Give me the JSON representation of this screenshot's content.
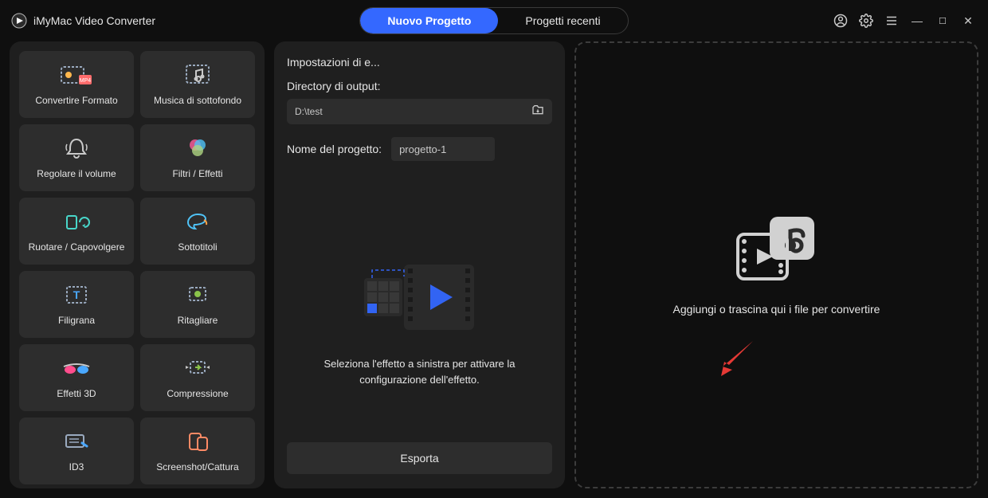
{
  "app": {
    "title": "iMyMac Video Converter"
  },
  "tabs": {
    "new_project": "Nuovo Progetto",
    "recent_projects": "Progetti recenti"
  },
  "sidebar": {
    "tools": [
      {
        "id": "convert-format",
        "label": "Convertire Formato"
      },
      {
        "id": "background-music",
        "label": "Musica di sottofondo"
      },
      {
        "id": "adjust-volume",
        "label": "Regolare il volume"
      },
      {
        "id": "filters-effects",
        "label": "Filtri / Effetti"
      },
      {
        "id": "rotate-flip",
        "label": "Ruotare / Capovolgere"
      },
      {
        "id": "subtitles",
        "label": "Sottotitoli"
      },
      {
        "id": "watermark",
        "label": "Filigrana"
      },
      {
        "id": "crop",
        "label": "Ritagliare"
      },
      {
        "id": "3d-effects",
        "label": "Effetti 3D"
      },
      {
        "id": "compression",
        "label": "Compressione"
      },
      {
        "id": "id3",
        "label": "ID3"
      },
      {
        "id": "screenshot-capture",
        "label": "Screenshot/Cattura"
      }
    ]
  },
  "settings": {
    "heading": "Impostazioni di e...",
    "output_dir_label": "Directory di output:",
    "output_dir_value": "D:\\test",
    "project_name_label": "Nome del progetto:",
    "project_name_value": "progetto-1",
    "effect_message": "Seleziona l'effetto a sinistra per attivare la configurazione dell'effetto.",
    "export_button": "Esporta"
  },
  "dropzone": {
    "message": "Aggiungi o trascina qui i file per convertire"
  }
}
